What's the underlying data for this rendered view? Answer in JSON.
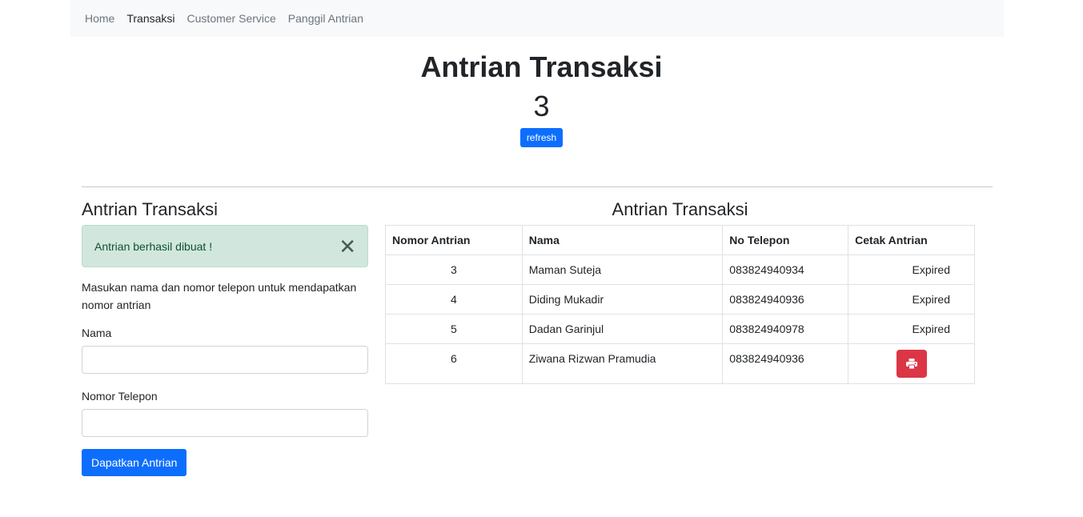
{
  "nav": {
    "items": [
      "Home",
      "Transaksi",
      "Customer Service",
      "Panggil Antrian"
    ],
    "active": 1
  },
  "hero": {
    "title": "Antrian Transaksi",
    "number": "3",
    "refresh_label": "refresh"
  },
  "form": {
    "title": "Antrian Transaksi",
    "alert": "Antrian berhasil dibuat !",
    "help": "Masukan nama dan nomor telepon untuk mendapatkan nomor antrian",
    "name_label": "Nama",
    "name_value": "",
    "phone_label": "Nomor Telepon",
    "phone_value": "",
    "submit_label": "Dapatkan Antrian"
  },
  "queue": {
    "title": "Antrian Transaksi",
    "headers": [
      "Nomor Antrian",
      "Nama",
      "No Telepon",
      "Cetak Antrian"
    ],
    "rows": [
      {
        "no": "3",
        "nama": "Maman Suteja",
        "telepon": "083824940934",
        "status": "Expired"
      },
      {
        "no": "4",
        "nama": "Diding Mukadir",
        "telepon": "083824940936",
        "status": "Expired"
      },
      {
        "no": "5",
        "nama": "Dadan Garinjul",
        "telepon": "083824940978",
        "status": "Expired"
      },
      {
        "no": "6",
        "nama": "Ziwana Rizwan Pramudia",
        "telepon": "083824940936",
        "status": "print-icon"
      }
    ]
  },
  "colors": {
    "primary": "#0d6efd",
    "danger": "#dc3545",
    "success_bg": "#d1e7dd",
    "navbar_bg": "#f8f9fa"
  }
}
